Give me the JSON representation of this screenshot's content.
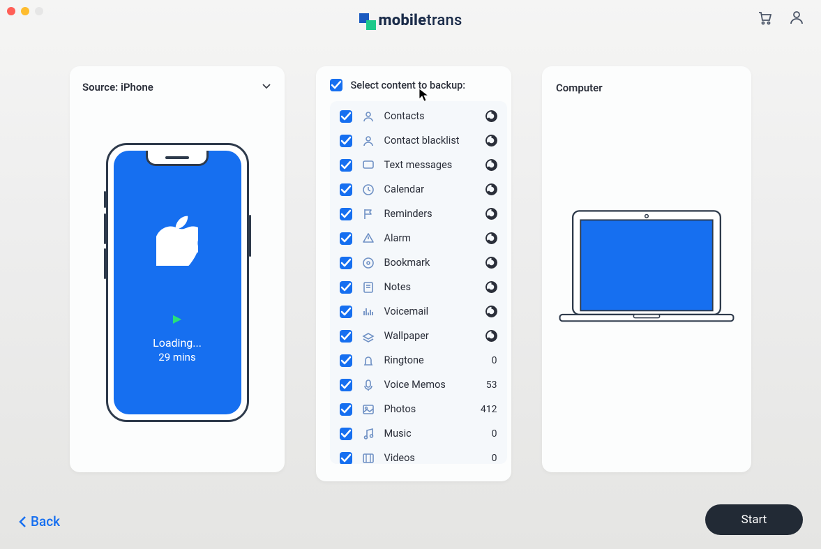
{
  "brand": {
    "name_a": "mobile",
    "name_b": "trans"
  },
  "source": {
    "title": "Source: iPhone",
    "loading": "Loading...",
    "eta": "29 mins"
  },
  "select": {
    "title": "Select content to backup:",
    "items": [
      {
        "label": "Contacts",
        "icon": "person",
        "loading": true
      },
      {
        "label": "Contact blacklist",
        "icon": "person",
        "loading": true
      },
      {
        "label": "Text messages",
        "icon": "chat",
        "loading": true
      },
      {
        "label": "Calendar",
        "icon": "calendar",
        "loading": true
      },
      {
        "label": "Reminders",
        "icon": "flag",
        "loading": true
      },
      {
        "label": "Alarm",
        "icon": "alarm",
        "loading": true
      },
      {
        "label": "Bookmark",
        "icon": "bookmark",
        "loading": true
      },
      {
        "label": "Notes",
        "icon": "note",
        "loading": true
      },
      {
        "label": "Voicemail",
        "icon": "voicemail",
        "loading": true
      },
      {
        "label": "Wallpaper",
        "icon": "wallpaper",
        "loading": true
      },
      {
        "label": "Ringtone",
        "icon": "bell",
        "loading": false,
        "count": "0"
      },
      {
        "label": "Voice Memos",
        "icon": "mic",
        "loading": false,
        "count": "53"
      },
      {
        "label": "Photos",
        "icon": "photo",
        "loading": false,
        "count": "412"
      },
      {
        "label": "Music",
        "icon": "music",
        "loading": false,
        "count": "0"
      },
      {
        "label": "Videos",
        "icon": "video",
        "loading": false,
        "count": "0"
      }
    ]
  },
  "dest": {
    "title": "Computer"
  },
  "footer": {
    "back": "Back",
    "start": "Start"
  }
}
